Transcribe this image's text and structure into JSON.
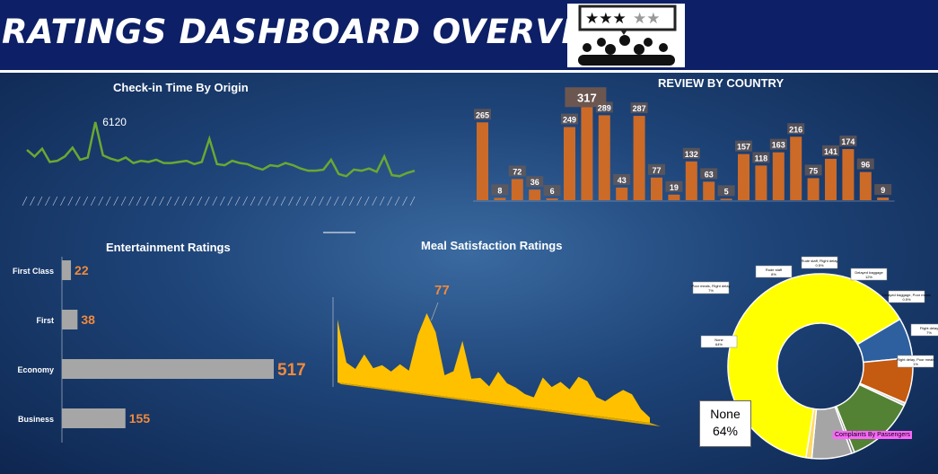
{
  "header": {
    "title": "RATINGS DASHBOARD OVERVIEW"
  },
  "colors": {
    "bar_orange": "#cc6a28",
    "line_green": "#6aa832",
    "area_yellow": "#ffc000",
    "hbar_gray": "#a6a6a6",
    "label_orange": "#f08a3c"
  },
  "checkin": {
    "title": "Check-in Time By Origin"
  },
  "review": {
    "title": "REVIEW BY COUNTRY"
  },
  "entertainment": {
    "title": "Entertainment Ratings"
  },
  "meal": {
    "title": "Meal Satisfaction Ratings"
  },
  "complaints": {
    "center_label": "None",
    "center_pct": "64%",
    "legend": "Complaints By Passengers"
  },
  "chart_data": [
    {
      "type": "line",
      "title": "Check-in Time By Origin",
      "annotation": "6120",
      "series": [
        {
          "values": [
            3600,
            3000,
            3700,
            2500,
            2600,
            3000,
            3800,
            2700,
            2900,
            6120,
            3100,
            2800,
            2600,
            2900,
            2400,
            2600,
            2500,
            2700,
            2400,
            2400,
            2500,
            2600,
            2300,
            2500,
            4600,
            2300,
            2200,
            2600,
            2400,
            2300,
            2000,
            1800,
            2200,
            2100,
            2400,
            2200,
            1900,
            1700,
            1700,
            1800,
            2700,
            1400,
            1200,
            1800,
            1700,
            1900,
            1600,
            3000,
            1300,
            1200,
            1500,
            1700
          ]
        }
      ]
    },
    {
      "type": "bar",
      "title": "REVIEW BY COUNTRY",
      "values": [
        265,
        8,
        72,
        36,
        6,
        249,
        317,
        289,
        43,
        287,
        77,
        19,
        132,
        63,
        5,
        157,
        118,
        163,
        216,
        75,
        141,
        174,
        96,
        9
      ],
      "ylim": [
        0,
        330
      ]
    },
    {
      "type": "bar",
      "title": "Entertainment Ratings",
      "categories": [
        "First Class",
        "First",
        "Economy",
        "Business"
      ],
      "values": [
        22,
        38,
        517,
        155
      ]
    },
    {
      "type": "area",
      "title": "Meal Satisfaction Ratings",
      "annotation": "77",
      "values": [
        60,
        20,
        15,
        30,
        18,
        22,
        17,
        25,
        20,
        55,
        77,
        60,
        20,
        25,
        55,
        20,
        22,
        15,
        30,
        20,
        17,
        12,
        10,
        30,
        22,
        28,
        22,
        35,
        32,
        18,
        15,
        22,
        28,
        25,
        12,
        5
      ]
    },
    {
      "type": "pie",
      "title": "Complaints By Passengers",
      "slices": [
        {
          "label": "None",
          "pct": 64,
          "color": "#ffff00"
        },
        {
          "label": "Poor meals, Flight delay",
          "pct": 7,
          "color": "#2e5f9e"
        },
        {
          "label": "Rude staff",
          "pct": 8,
          "color": "#c55a11"
        },
        {
          "label": "Rude staff, Flight delay",
          "pct": 0.5,
          "color": "#d0d0d0"
        },
        {
          "label": "Delayed baggage",
          "pct": 12,
          "color": "#548235"
        },
        {
          "label": "Delayed baggage, Poor meals",
          "pct": 0.5,
          "color": "#7f7f7f"
        },
        {
          "label": "Flight delay",
          "pct": 7,
          "color": "#a5a5a5"
        },
        {
          "label": "Flight delay, Poor meals",
          "pct": 1,
          "color": "#ffd966"
        }
      ]
    }
  ]
}
